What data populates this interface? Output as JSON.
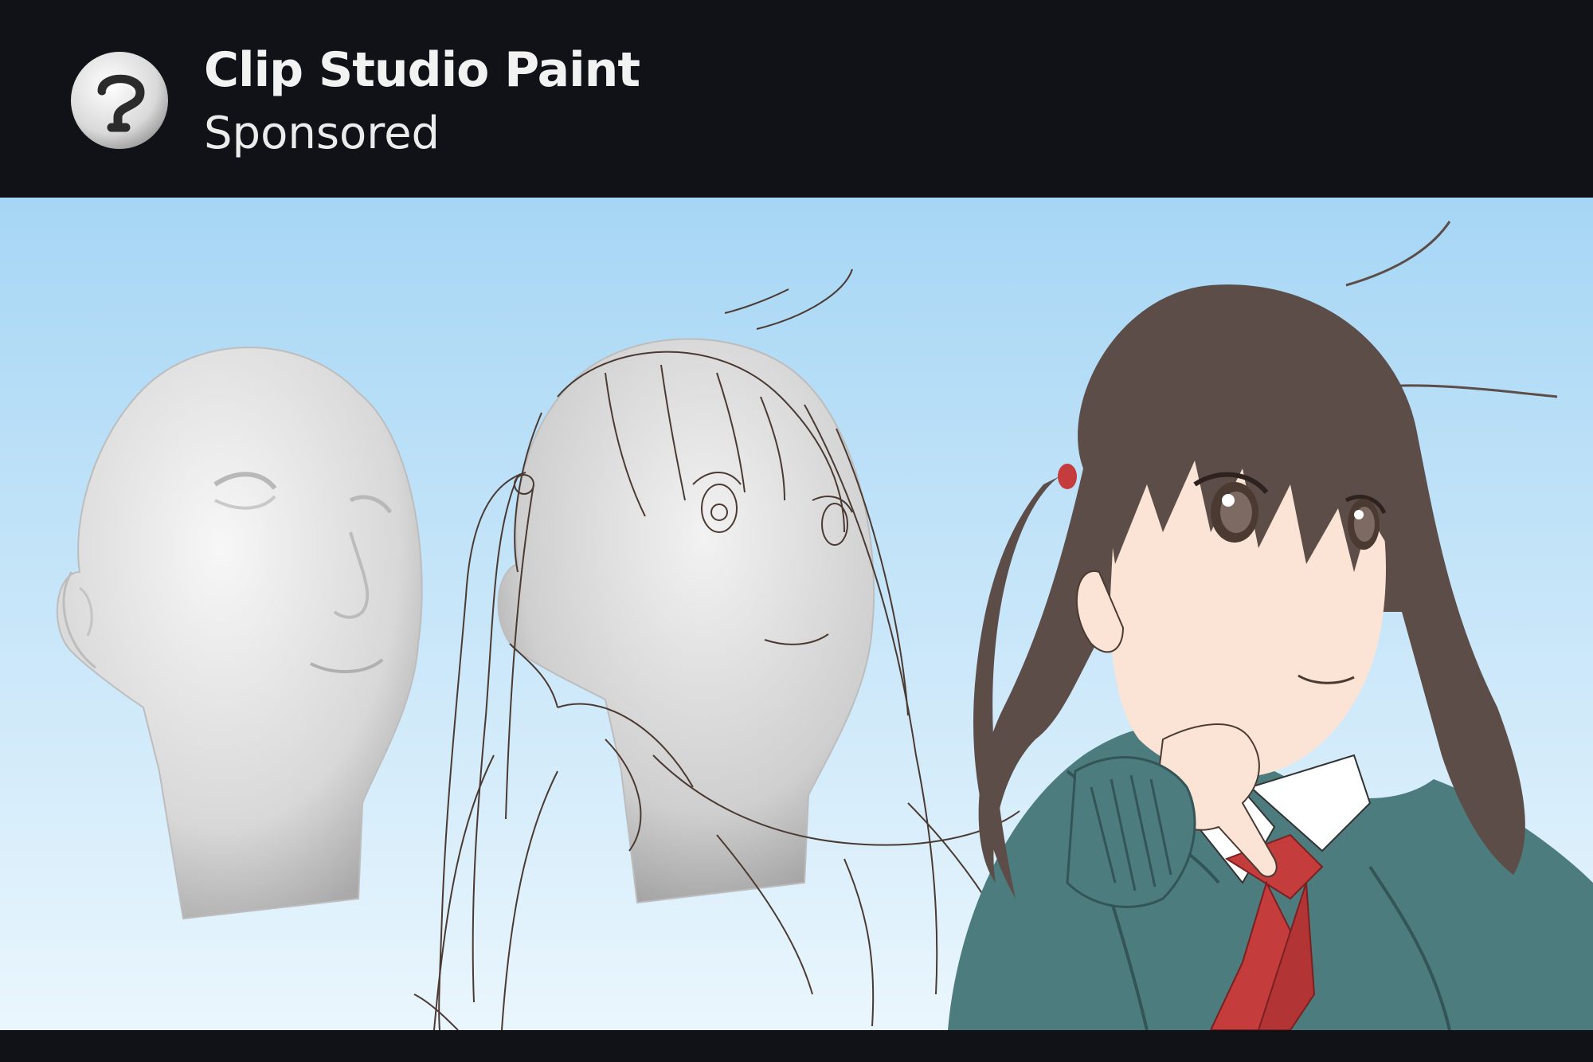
{
  "ad": {
    "advertiser": "Clip Studio Paint",
    "label": "Sponsored"
  },
  "media": {
    "panels": [
      "3d-head-model",
      "sketch-over-model",
      "finished-colored-illustration"
    ]
  },
  "colors": {
    "header_bg": "#111217",
    "sky_top": "#a6d6f5",
    "sky_bottom": "#eaf6fd",
    "sweater": "#4d7c7f",
    "bow": "#c43c3c",
    "hair": "#5c4d48",
    "skin": "#fbe4d6"
  },
  "icons": {
    "logo": "clip-studio-logo-icon"
  }
}
